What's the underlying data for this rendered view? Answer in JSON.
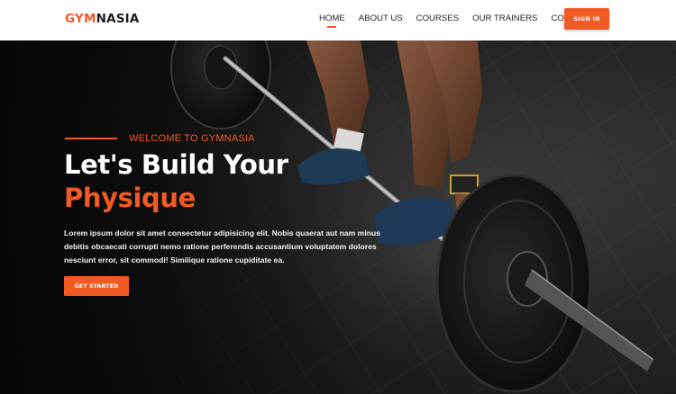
{
  "brand": {
    "part1": "GYM",
    "part2": "NASIA",
    "accent_color": "#f15a24"
  },
  "nav": {
    "items": [
      {
        "label": "HOME",
        "active": true
      },
      {
        "label": "ABOUT US"
      },
      {
        "label": "COURSES"
      },
      {
        "label": "OUR TRAINERS"
      },
      {
        "label": "CONTACT"
      }
    ],
    "signin_label": "SIGN IN"
  },
  "hero": {
    "welcome": "WELCOME TO GYMNASIA",
    "headline_line1": "Let's Build Your",
    "headline_line2": "Physique",
    "description": "Lorem ipsum dolor sit amet consectetur adipisicing elit. Nobis quaerat aut nam minus debitis obcaecati corrupti nemo ratione perferendis accusantium voluptatem dolores nesciunt error, sit commodi! Similique ratione cupiditate ea.",
    "cta_label": "GET STARTED",
    "background_icon": "barbell-deadlift-photo"
  }
}
